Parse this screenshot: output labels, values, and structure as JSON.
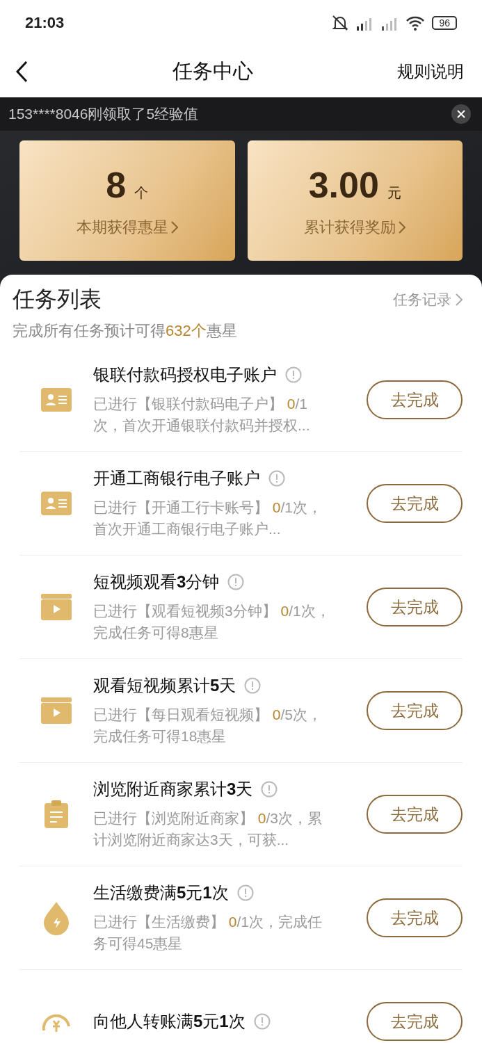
{
  "status_bar": {
    "time": "21:03",
    "battery": "96"
  },
  "nav": {
    "title": "任务中心",
    "action": "规则说明"
  },
  "ticker": {
    "text": "153****8046刚领取了5经验值"
  },
  "stats": [
    {
      "value": "8",
      "unit": "个",
      "label": "本期获得惠星"
    },
    {
      "value": "3.00",
      "unit": "元",
      "label": "累计获得奖励"
    }
  ],
  "task_list": {
    "title": "任务列表",
    "record_link": "任务记录",
    "summary_before": "完成所有任务预计可得",
    "summary_highlight": "632个",
    "summary_after": "惠星",
    "tasks": [
      {
        "kind": "card",
        "title": "银联付款码授权电子账户",
        "desc_before": "已进行【银联付款码电子户】 ",
        "progress": "0",
        "desc_after": "/1次，首次开通银联付款码并授权...",
        "button": "去完成"
      },
      {
        "kind": "card",
        "title": "开通工商银行电子账户",
        "desc_before": "已进行【开通工行卡账号】 ",
        "progress": "0",
        "desc_after": "/1次，首次开通工商银行电子账户...",
        "button": "去完成"
      },
      {
        "kind": "video",
        "title": "短视频观看**3**分钟",
        "desc_before": "已进行【观看短视频3分钟】 ",
        "progress": "0",
        "desc_after": "/1次，完成任务可得8惠星",
        "button": "去完成"
      },
      {
        "kind": "video",
        "title": "观看短视频累计**5**天",
        "desc_before": "已进行【每日观看短视频】 ",
        "progress": "0",
        "desc_after": "/5次，完成任务可得18惠星",
        "button": "去完成"
      },
      {
        "kind": "clipboard",
        "title": "浏览附近商家累计**3**天",
        "desc_before": "已进行【浏览附近商家】 ",
        "progress": "0",
        "desc_after": "/3次，累计浏览附近商家达3天，可获...",
        "button": "去完成"
      },
      {
        "kind": "drop",
        "title": "生活缴费满**5**元**1**次",
        "desc_before": "已进行【生活缴费】 ",
        "progress": "0",
        "desc_after": "/1次，完成任务可得45惠星",
        "button": "去完成"
      },
      {
        "kind": "transfer",
        "title": "向他人转账满**5**元**1**次",
        "button": "去完成"
      }
    ]
  }
}
